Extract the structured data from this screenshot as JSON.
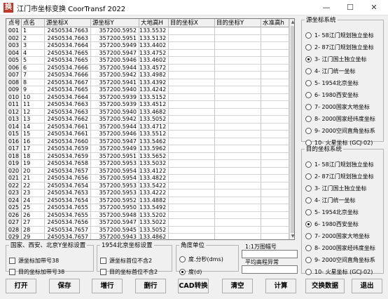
{
  "window": {
    "title": "江门市坐标变换 CoorTransf 2022",
    "icon_glyph": "换",
    "min_glyph": "—",
    "max_glyph": "☐",
    "close_glyph": "✕"
  },
  "grid": {
    "headers": [
      "点号",
      "点名",
      "源坐标X",
      "源坐标Y",
      "大地高H",
      "目的坐标X",
      "目的坐标Y",
      "水准高h"
    ],
    "rows": [
      [
        "001",
        "1",
        "2450534.7663",
        "357200.5952",
        "133.5532"
      ],
      [
        "002",
        "2",
        "2450534.7663",
        "357200.5951",
        "133.5132"
      ],
      [
        "003",
        "3",
        "2450534.7664",
        "357200.5949",
        "133.4402"
      ],
      [
        "004",
        "4",
        "2450534.7665",
        "357200.5947",
        "133.4752"
      ],
      [
        "005",
        "5",
        "2450534.7665",
        "357200.5946",
        "133.4602"
      ],
      [
        "006",
        "6",
        "2450534.7666",
        "357200.5944",
        "133.4572"
      ],
      [
        "007",
        "7",
        "2450534.7666",
        "357200.5942",
        "133.4982"
      ],
      [
        "008",
        "8",
        "2450534.7667",
        "357200.5941",
        "133.4392"
      ],
      [
        "009",
        "9",
        "2450534.7665",
        "357200.5940",
        "133.4242"
      ],
      [
        "010",
        "10",
        "2450534.7664",
        "357200.5939",
        "133.5152"
      ],
      [
        "011",
        "11",
        "2450534.7663",
        "357200.5939",
        "133.4512"
      ],
      [
        "012",
        "12",
        "2450534.7663",
        "357200.5940",
        "133.4682"
      ],
      [
        "013",
        "13",
        "2450534.7662",
        "357200.5942",
        "133.5052"
      ],
      [
        "014",
        "14",
        "2450534.7661",
        "357200.5944",
        "133.4712"
      ],
      [
        "015",
        "15",
        "2450534.7661",
        "357200.5946",
        "133.5512"
      ],
      [
        "016",
        "16",
        "2450534.7660",
        "357200.5947",
        "133.5462"
      ],
      [
        "017",
        "17",
        "2450534.7659",
        "357200.5949",
        "133.5962"
      ],
      [
        "018",
        "18",
        "2450534.7659",
        "357200.5951",
        "133.5652"
      ],
      [
        "019",
        "19",
        "2450534.7658",
        "357200.5953",
        "133.5032"
      ],
      [
        "020",
        "20",
        "2450534.7657",
        "357200.5954",
        "133.4122"
      ],
      [
        "021",
        "21",
        "2450534.7656",
        "357200.5954",
        "133.4822"
      ],
      [
        "022",
        "22",
        "2450534.7654",
        "357200.5953",
        "133.5422"
      ],
      [
        "023",
        "23",
        "2450534.7653",
        "357200.5953",
        "133.4222"
      ],
      [
        "024",
        "24",
        "2450534.7654",
        "357200.5952",
        "133.4882"
      ],
      [
        "025",
        "25",
        "2450534.7655",
        "357200.5950",
        "133.5492"
      ],
      [
        "026",
        "26",
        "2450534.7655",
        "357200.5948",
        "133.5202"
      ],
      [
        "027",
        "27",
        "2450534.7656",
        "357200.5947",
        "133.5022"
      ],
      [
        "028",
        "28",
        "2450534.7657",
        "357200.5945",
        "133.5052"
      ],
      [
        "029",
        "29",
        "2450534.7657",
        "357200.5943",
        "133.4862"
      ]
    ],
    "scroll_up_glyph": "▲",
    "scroll_down_glyph": "▼"
  },
  "source_system": {
    "title": "源坐标系统",
    "options": [
      "1- 58江门规划独立坐标",
      "2- 87江门规划独立坐标",
      "3- 江门国土独立坐标",
      "4- 江门统一坐标",
      "5- 1954北京坐标",
      "6- 1980西安坐标",
      "7- 2000国家大地坐标",
      "8- 2000国家经纬度坐标",
      "9- 2000空间直角坐标系",
      "10- 火星坐标 (GCJ-02)"
    ],
    "selected_index": 2
  },
  "target_system": {
    "title": "目的坐标系统",
    "options": [
      "1- 58江门规划独立坐标",
      "2- 87江门规划独立坐标",
      "3- 江门国土独立坐标",
      "4- 江门统一坐标",
      "5- 1954北京坐标",
      "6- 1980西安坐标",
      "7- 2000国家大地坐标",
      "8- 2000国家经纬度坐标",
      "9- 2000空间直角坐标系",
      "10- 火星坐标 (GCJ-02)"
    ],
    "selected_index": 5
  },
  "settings_a": {
    "title": "国家、西安、北京Y坐标设置",
    "opt1": "源坐标加带号38",
    "opt2": "目的坐标加带号38"
  },
  "settings_b": {
    "title": "1954北京坐标设置",
    "opt1": "源坐标首位不含2",
    "opt2": "目的坐标首位不含2"
  },
  "angle_unit": {
    "title": "角度单位",
    "opt1": "度.分秒(dms)",
    "opt2": "度(d)",
    "selected_index": 1
  },
  "map_sheet": {
    "label": "1:1万图幅号"
  },
  "avg_elev": {
    "label": "平均高程异常"
  },
  "buttons": {
    "open": "打开",
    "save": "保存",
    "add_row": "增行",
    "delete_row": "删行",
    "cad": "CAD转换",
    "clear": "清空",
    "compute": "计算",
    "swap": "交换数据",
    "exit": "退出"
  }
}
